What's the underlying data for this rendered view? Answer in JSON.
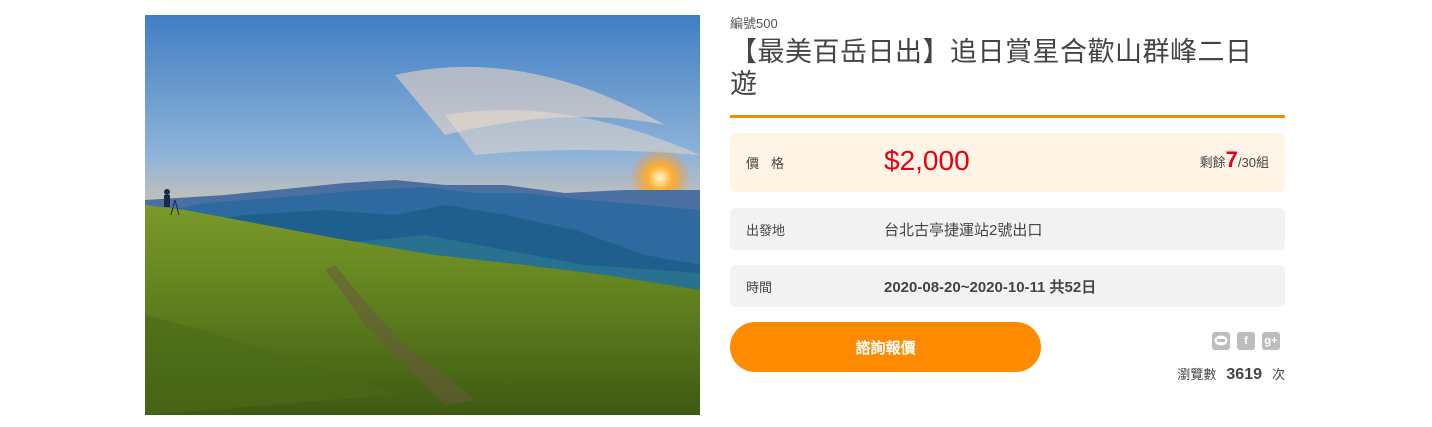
{
  "product": {
    "code": "編號500",
    "title": "【最美百岳日出】追日賞星合歡山群峰二日遊"
  },
  "price_row": {
    "label": "價格",
    "price": "$2,000",
    "remaining_prefix": "剩餘",
    "remaining_count": "7",
    "remaining_suffix": "/30組"
  },
  "depart_row": {
    "label": "出發地",
    "value": "台北古亭捷運站2號出口"
  },
  "time_row": {
    "label": "時間",
    "value": "2020-08-20~2020-10-11 共52日"
  },
  "actions": {
    "inquire_label": "諮詢報價"
  },
  "share": {
    "icons": [
      "line-icon",
      "facebook-icon",
      "google-plus-icon"
    ],
    "fb_glyph": "f",
    "gplus_glyph": "g+"
  },
  "views": {
    "label": "瀏覽數",
    "count": "3619",
    "unit": "次"
  },
  "colors": {
    "accent": "#ff8c00",
    "price": "#e60012",
    "rule": "#f08c00"
  }
}
